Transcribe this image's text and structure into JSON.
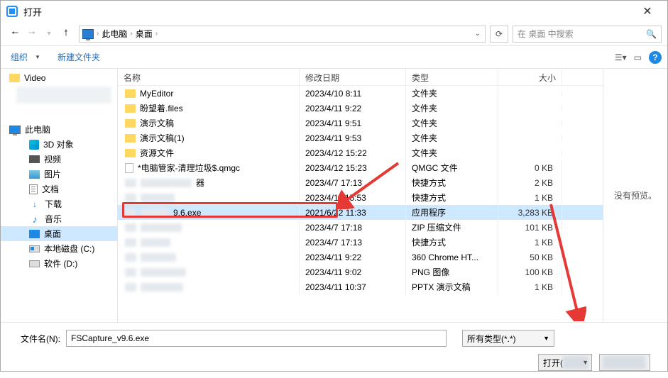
{
  "title": "打开",
  "nav": {
    "path": [
      "此电脑",
      "桌面"
    ],
    "search_placeholder": "在 桌面 中搜索"
  },
  "toolbar": {
    "organize": "组织",
    "new_folder": "新建文件夹"
  },
  "tree": {
    "video": "Video",
    "this_pc": "此电脑",
    "obj3d": "3D 对象",
    "videos": "视频",
    "pictures": "图片",
    "documents": "文档",
    "downloads": "下载",
    "music": "音乐",
    "desktop": "桌面",
    "local_c": "本地磁盘 (C:)",
    "soft_d": "软件 (D:)"
  },
  "columns": {
    "name": "名称",
    "date": "修改日期",
    "type": "类型",
    "size": "大小"
  },
  "rows": [
    {
      "icon": "folder",
      "name": "MyEditor",
      "date": "2023/4/10 8:11",
      "type": "文件夹",
      "size": ""
    },
    {
      "icon": "folder",
      "name": "盼望着.files",
      "date": "2023/4/11 9:22",
      "type": "文件夹",
      "size": ""
    },
    {
      "icon": "folder",
      "name": "演示文稿",
      "date": "2023/4/11 9:51",
      "type": "文件夹",
      "size": ""
    },
    {
      "icon": "folder",
      "name": "演示文稿(1)",
      "date": "2023/4/11 9:53",
      "type": "文件夹",
      "size": ""
    },
    {
      "icon": "folder",
      "name": "资源文件",
      "date": "2023/4/12 15:22",
      "type": "文件夹",
      "size": ""
    },
    {
      "icon": "file",
      "name": "*电脑管家-清理垃圾$.qmgc",
      "date": "2023/4/12 15:23",
      "type": "QMGC 文件",
      "size": "0 KB"
    },
    {
      "icon": "blur",
      "blur_w": 72,
      "name": "器",
      "date": "2023/4/7 17:13",
      "type": "快捷方式",
      "size": "2 KB"
    },
    {
      "icon": "blur",
      "blur_w": 48,
      "name": "",
      "date": "2023/4/11 15:53",
      "type": "快捷方式",
      "size": "1 KB"
    },
    {
      "icon": "blur",
      "blur_w": 40,
      "name": "9.6.exe",
      "date": "2021/6/22 11:33",
      "type": "应用程序",
      "size": "3,283 KB",
      "selected": true
    },
    {
      "icon": "blur",
      "blur_w": 58,
      "name": "",
      "date": "2023/4/7 17:18",
      "type": "ZIP 压缩文件",
      "size": "101 KB"
    },
    {
      "icon": "blur",
      "blur_w": 42,
      "name": "",
      "date": "2023/4/7 17:13",
      "type": "快捷方式",
      "size": "1 KB"
    },
    {
      "icon": "blur",
      "blur_w": 50,
      "name": "",
      "date": "2023/4/11 9:22",
      "type": "360 Chrome HT...",
      "size": "50 KB"
    },
    {
      "icon": "blur",
      "blur_w": 64,
      "name": "",
      "date": "2023/4/11 9:02",
      "type": "PNG 图像",
      "size": "100 KB"
    },
    {
      "icon": "blur",
      "blur_w": 60,
      "name": "",
      "date": "2023/4/11 10:37",
      "type": "PPTX 演示文稿",
      "size": "1 KB"
    }
  ],
  "preview_text": "没有预览。",
  "footer": {
    "filename_label": "文件名(N):",
    "filename_value": "FSCapture_v9.6.exe",
    "filter": "所有类型(*.*)",
    "open": "打开(",
    "cancel": ""
  }
}
